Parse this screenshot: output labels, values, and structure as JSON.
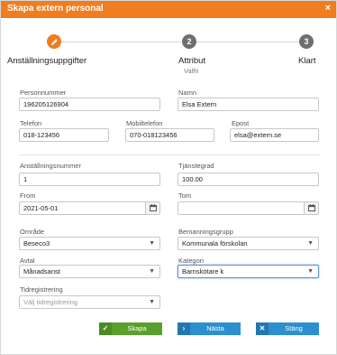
{
  "dialog": {
    "title": "Skapa extern personal",
    "close_glyph": "×"
  },
  "wizard": {
    "steps": [
      {
        "number": "",
        "label": "Anställningsuppgifter",
        "sub": "",
        "state": "active",
        "icon": "pencil-icon"
      },
      {
        "number": "2",
        "label": "Attribut",
        "sub": "Valfri",
        "state": "pending"
      },
      {
        "number": "3",
        "label": "Klart",
        "sub": "",
        "state": "pending"
      }
    ]
  },
  "form": {
    "personnummer": {
      "label": "Personnummer",
      "value": "196205126904"
    },
    "namn": {
      "label": "Namn",
      "value": "Elsa Extern"
    },
    "telefon": {
      "label": "Telefon",
      "value": "018-123456"
    },
    "mobiltelefon": {
      "label": "Mobiltelefon",
      "value": "070-018123456"
    },
    "epost": {
      "label": "Epost",
      "value": "elsa@extern.se"
    },
    "anstallningsnummer": {
      "label": "Anställningsnummer",
      "value": "1"
    },
    "tjanstegrad": {
      "label": "Tjänstegrad",
      "value": "100.00"
    },
    "from": {
      "label": "From",
      "value": "2021-05-01"
    },
    "tom": {
      "label": "Tom",
      "value": ""
    },
    "omrade": {
      "label": "Område",
      "value": "Beseco3"
    },
    "bemanningsgrupp": {
      "label": "Bemanningsgrupp",
      "value": "Kommunala förskolan"
    },
    "avtal": {
      "label": "Avtal",
      "value": "Månadsanst"
    },
    "kategori": {
      "label": "Kategori",
      "value": "Barnskötare k"
    },
    "tidregistrering": {
      "label": "Tidregistrering",
      "placeholder": "Välj tidregistrering"
    }
  },
  "buttons": {
    "create": {
      "label": "Skapa",
      "icon": "check-icon"
    },
    "next": {
      "label": "Nästa",
      "icon": "chevron-right-icon"
    },
    "close": {
      "label": "Stäng",
      "icon": "close-icon"
    }
  },
  "colors": {
    "accent": "#f07d1f",
    "green": "#5aa02c",
    "blue": "#2b8fd0"
  }
}
